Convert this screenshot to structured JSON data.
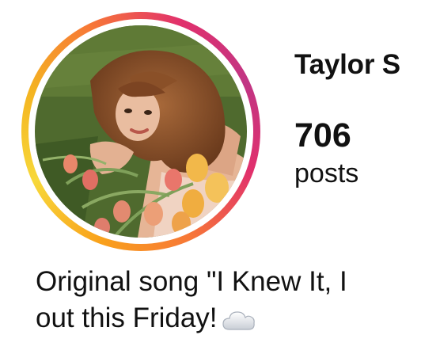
{
  "profile": {
    "username": "Taylor S",
    "posts_count": "706",
    "posts_label": "posts",
    "bio_line1": "Original song \"I Knew It, I",
    "bio_line2": "out this Friday!",
    "bio_emoji": "cloud-emoji"
  },
  "colors": {
    "ring_gradient": [
      "#f9a11b",
      "#f7d83a",
      "#f77737",
      "#e1306c",
      "#c13584"
    ],
    "text": "#111111",
    "background": "#ffffff"
  }
}
